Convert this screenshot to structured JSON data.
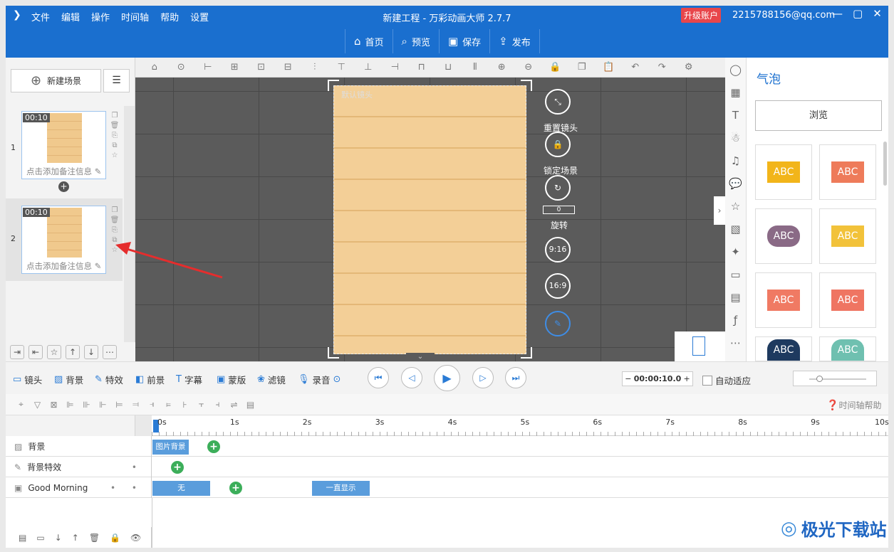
{
  "window": {
    "title": "新建工程 - 万彩动画大师 2.7.7",
    "upgrade": "升级账户",
    "email": "2215788156@qq.com",
    "menu": [
      "文件",
      "编辑",
      "操作",
      "时间轴",
      "帮助",
      "设置"
    ],
    "controls": [
      "—",
      "▢",
      "✕"
    ]
  },
  "topbar": {
    "buttons": [
      {
        "label": "首页",
        "icon": "⌂"
      },
      {
        "label": "预览",
        "icon": "⌕"
      },
      {
        "label": "保存",
        "icon": "▣"
      },
      {
        "label": "发布",
        "icon": "⇪"
      }
    ]
  },
  "scenes": {
    "new_label": "新建场景",
    "items": [
      {
        "num": "1",
        "time": "00:10",
        "note": "点击添加备注信息"
      },
      {
        "num": "2",
        "time": "00:10",
        "note": "点击添加备注信息"
      }
    ]
  },
  "stage": {
    "camera_label": "默认镜头",
    "buttons": [
      {
        "label": "重置镜头",
        "glyph": "⤡"
      },
      {
        "label": "锁定场景",
        "glyph": "🔒"
      },
      {
        "label": "旋转",
        "glyph": "↻",
        "value": "0"
      },
      {
        "label": "",
        "glyph": "9:16"
      },
      {
        "label": "",
        "glyph": "16:9"
      }
    ]
  },
  "right": {
    "title": "气泡",
    "browse": "浏览",
    "bubble_text": "ABC",
    "bubble_colors": [
      "#f2b51a",
      "#ee7b5a",
      "#8a6a86",
      "#f2c23a",
      "#ef7562",
      "#f07a63",
      "#1e3a5f",
      "#6fc0b0"
    ]
  },
  "ctrl": {
    "items": [
      {
        "icon": "▭",
        "label": "镜头"
      },
      {
        "icon": "▨",
        "label": "背景"
      },
      {
        "icon": "✎",
        "label": "特效"
      },
      {
        "icon": "◧",
        "label": "前景"
      },
      {
        "icon": "T",
        "label": "字幕"
      },
      {
        "icon": "▣",
        "label": "蒙版"
      },
      {
        "icon": "❀",
        "label": "滤镜"
      },
      {
        "icon": "🎙",
        "label": "录音"
      }
    ],
    "time": "00:00:10.0",
    "autofit": "自动适应",
    "help": "时间轴帮助"
  },
  "ruler": [
    "0s",
    "1s",
    "2s",
    "3s",
    "4s",
    "5s",
    "6s",
    "7s",
    "8s",
    "9s",
    "10s"
  ],
  "tracks": [
    {
      "name": "背景",
      "clips": [
        {
          "text": "图片背景"
        }
      ]
    },
    {
      "name": "背景特效",
      "clips": []
    },
    {
      "name": "Good Morning",
      "clips": [
        {
          "text": "无"
        },
        {
          "text": "一直显示"
        }
      ]
    }
  ],
  "watermark": "极光下载站"
}
